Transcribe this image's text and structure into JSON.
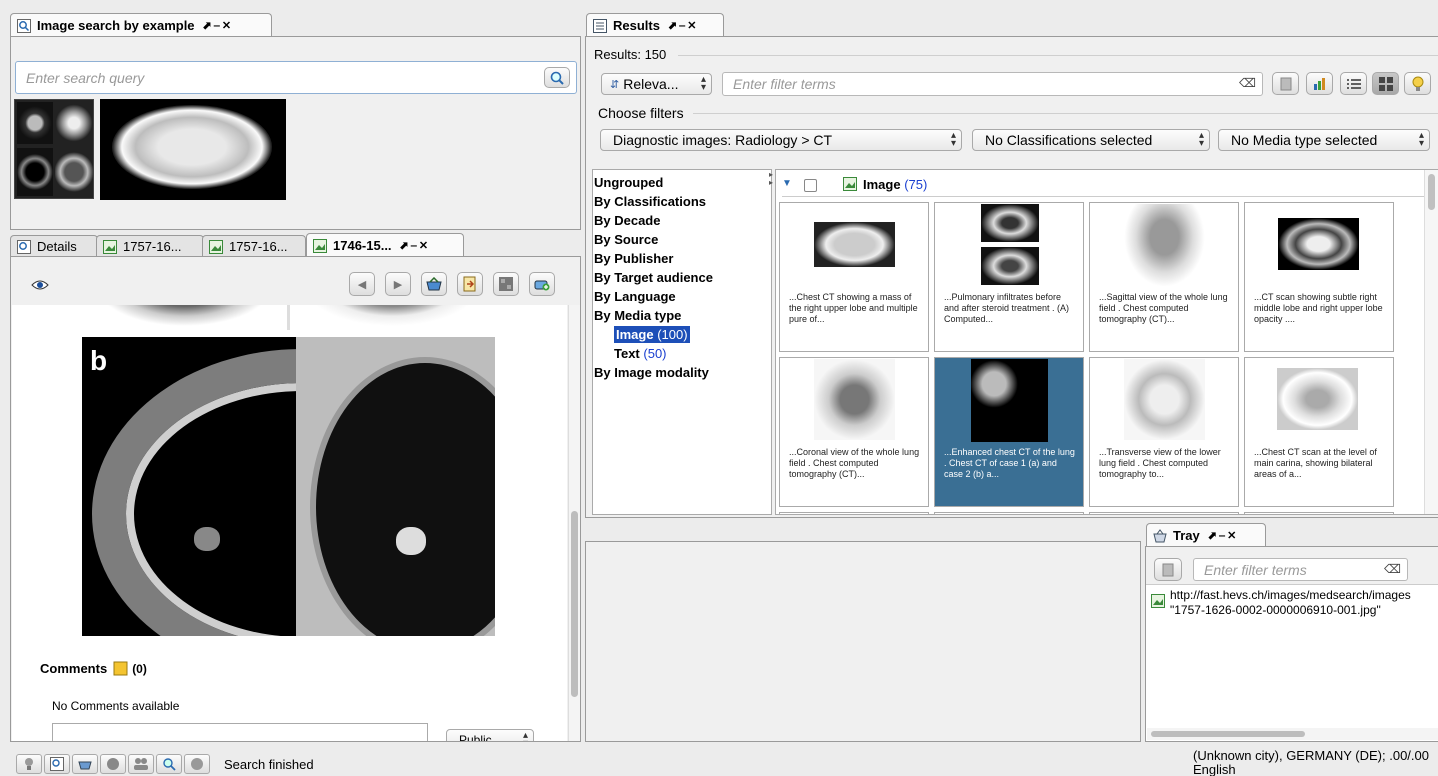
{
  "search_panel": {
    "tab": "Image search by example",
    "placeholder": "Enter search query"
  },
  "details_tabs": [
    {
      "label": "Details"
    },
    {
      "label": "1757-16..."
    },
    {
      "label": "1757-16..."
    },
    {
      "label": "1746-15..."
    }
  ],
  "image_panel": {
    "figure_label": "b",
    "comments_label": "Comments",
    "comments_count": "(0)",
    "no_comments": "No Comments available",
    "visibility": "Public"
  },
  "results": {
    "tab": "Results",
    "count_label": "Results: 150",
    "sort": "Releva...",
    "filter_placeholder": "Enter filter terms",
    "choose_filters": "Choose filters",
    "filters": [
      "Diagnostic images: Radiology > CT",
      "No Classifications selected",
      "No Media type selected"
    ],
    "tree": {
      "items": [
        "Ungrouped",
        "By Classifications",
        "By Decade",
        "By Source",
        "By Publisher",
        "By Target audience",
        "By Language",
        "By Media type",
        "By Image modality"
      ],
      "children": [
        {
          "label": "Image",
          "count": "(100)"
        },
        {
          "label": "Text",
          "count": "(50)"
        }
      ]
    },
    "group": {
      "label": "Image",
      "count": "(75)"
    },
    "thumbs": [
      {
        "caption": "...Chest CT showing a mass of the right upper lobe and multiple pure of..."
      },
      {
        "caption": "...Pulmonary infiltrates before and after steroid treatment . (A) Computed..."
      },
      {
        "caption": "...Sagittal view of the whole lung field . Chest computed tomography (CT)..."
      },
      {
        "caption": "...CT scan showing subtle right middle lobe and right upper lobe opacity ...."
      },
      {
        "caption": "...Coronal view of the whole lung field . Chest computed tomography (CT)..."
      },
      {
        "caption": "...Enhanced chest CT of the lung . Chest CT of case 1 (a) and case 2 (b) a..."
      },
      {
        "caption": "...Transverse view of the lower lung field . Chest computed tomography to..."
      },
      {
        "caption": "...Chest CT scan at the level of main carina, showing bilateral areas of a..."
      }
    ]
  },
  "tray": {
    "tab": "Tray",
    "filter_placeholder": "Enter filter terms",
    "item_line1": "http://fast.hevs.ch/images/medsearch/images",
    "item_line2": "\"1757-1626-0002-0000006910-001.jpg\""
  },
  "status": {
    "text": "Search finished",
    "location": "(Unknown city), GERMANY (DE); .00/.00",
    "language": "English"
  },
  "colors": {
    "selection": "#3a6f94",
    "link": "#1a3fd0",
    "highlight": "#1d4fb8"
  }
}
